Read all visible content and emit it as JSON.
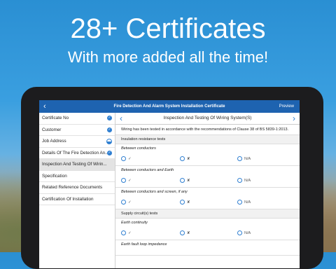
{
  "headline": {
    "title": "28+ Certificates",
    "subtitle": "With more added all the time!"
  },
  "app": {
    "back_icon": "chevron-left-icon",
    "window_title": "Fire Detection And Alarm System Installation Certificate",
    "preview_label": "Preview"
  },
  "sidebar": {
    "items": [
      {
        "label": "Certificate No",
        "status": "complete"
      },
      {
        "label": "Customer",
        "status": "complete"
      },
      {
        "label": "Job Address",
        "status": "partial"
      },
      {
        "label": "Details Of The Fire Detection An...",
        "status": "complete"
      },
      {
        "label": "Inspection And Testing Of Wirin...",
        "status": "active"
      },
      {
        "label": "Specification",
        "status": "none"
      },
      {
        "label": "Related Reference Documents",
        "status": "none"
      },
      {
        "label": "Certification Of Installation",
        "status": "none"
      }
    ]
  },
  "main": {
    "title": "Inspection And Testing Of Wiring System(S)",
    "note": "Wiring has been tested in accordance with the recommendations of Clause 38 of BS 5839-1:2013.",
    "sections": [
      {
        "title": "Insulation resistance tests"
      },
      {
        "title": "Supply circuit(s) tests"
      }
    ],
    "questions": [
      {
        "label": "Between conductors"
      },
      {
        "label": "Between conductors and Earth"
      },
      {
        "label": "Between conductors and screen, if any"
      },
      {
        "label": "Earth continuity"
      },
      {
        "label": "Earth fault loop impedance"
      }
    ],
    "options": {
      "pass": "✓",
      "fail": "✘",
      "na": "N/A"
    }
  },
  "colors": {
    "brand": "#1e63b0",
    "accent": "#2f7fd1"
  }
}
